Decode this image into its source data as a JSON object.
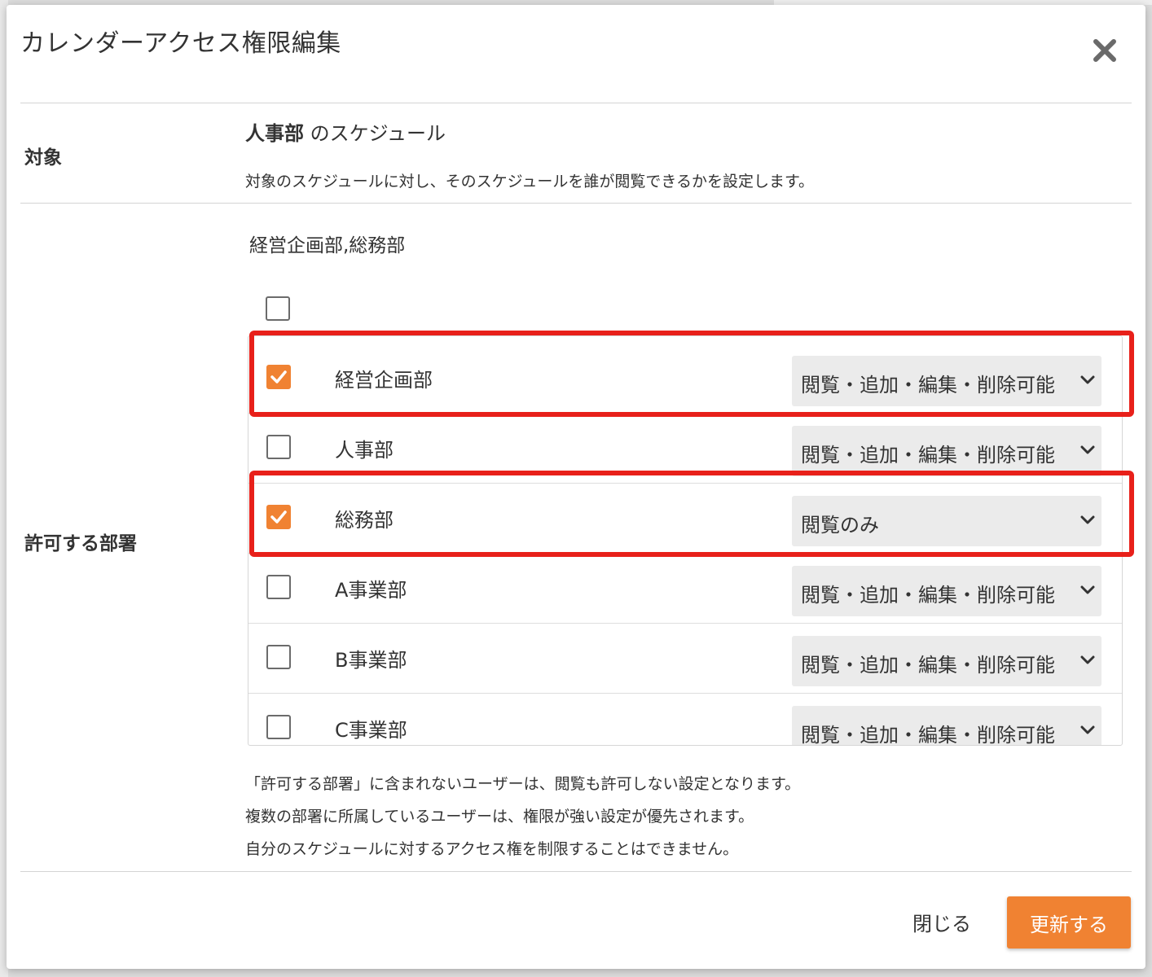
{
  "dialog": {
    "title": "カレンダーアクセス権限編集",
    "close_icon": "close-icon"
  },
  "target": {
    "label": "対象",
    "department": "人事部",
    "suffix": " のスケジュール",
    "description": "対象のスケジュールに対し、そのスケジュールを誰が閲覧できるかを設定します。"
  },
  "allowed": {
    "label": "許可する部署",
    "summary": "経営企画部,総務部",
    "select_all_checked": false,
    "departments": [
      {
        "name": "経営企画部",
        "checked": true,
        "permission": "閲覧・追加・編集・削除可能"
      },
      {
        "name": "人事部",
        "checked": false,
        "permission": "閲覧・追加・編集・削除可能"
      },
      {
        "name": "総務部",
        "checked": true,
        "permission": "閲覧のみ"
      },
      {
        "name": "A事業部",
        "checked": false,
        "permission": "閲覧・追加・編集・削除可能"
      },
      {
        "name": "B事業部",
        "checked": false,
        "permission": "閲覧・追加・編集・削除可能"
      },
      {
        "name": "C事業部",
        "checked": false,
        "permission": "閲覧・追加・編集・削除可能"
      }
    ]
  },
  "notes": [
    "「許可する部署」に含まれないユーザーは、閲覧も許可しない設定となります。",
    "複数の部署に所属しているユーザーは、権限が強い設定が優先されます。",
    "自分のスケジュールに対するアクセス権を制限することはできません。"
  ],
  "footer": {
    "close_label": "閉じる",
    "update_label": "更新する"
  },
  "colors": {
    "accent": "#f08232",
    "highlight": "#e8201a"
  }
}
